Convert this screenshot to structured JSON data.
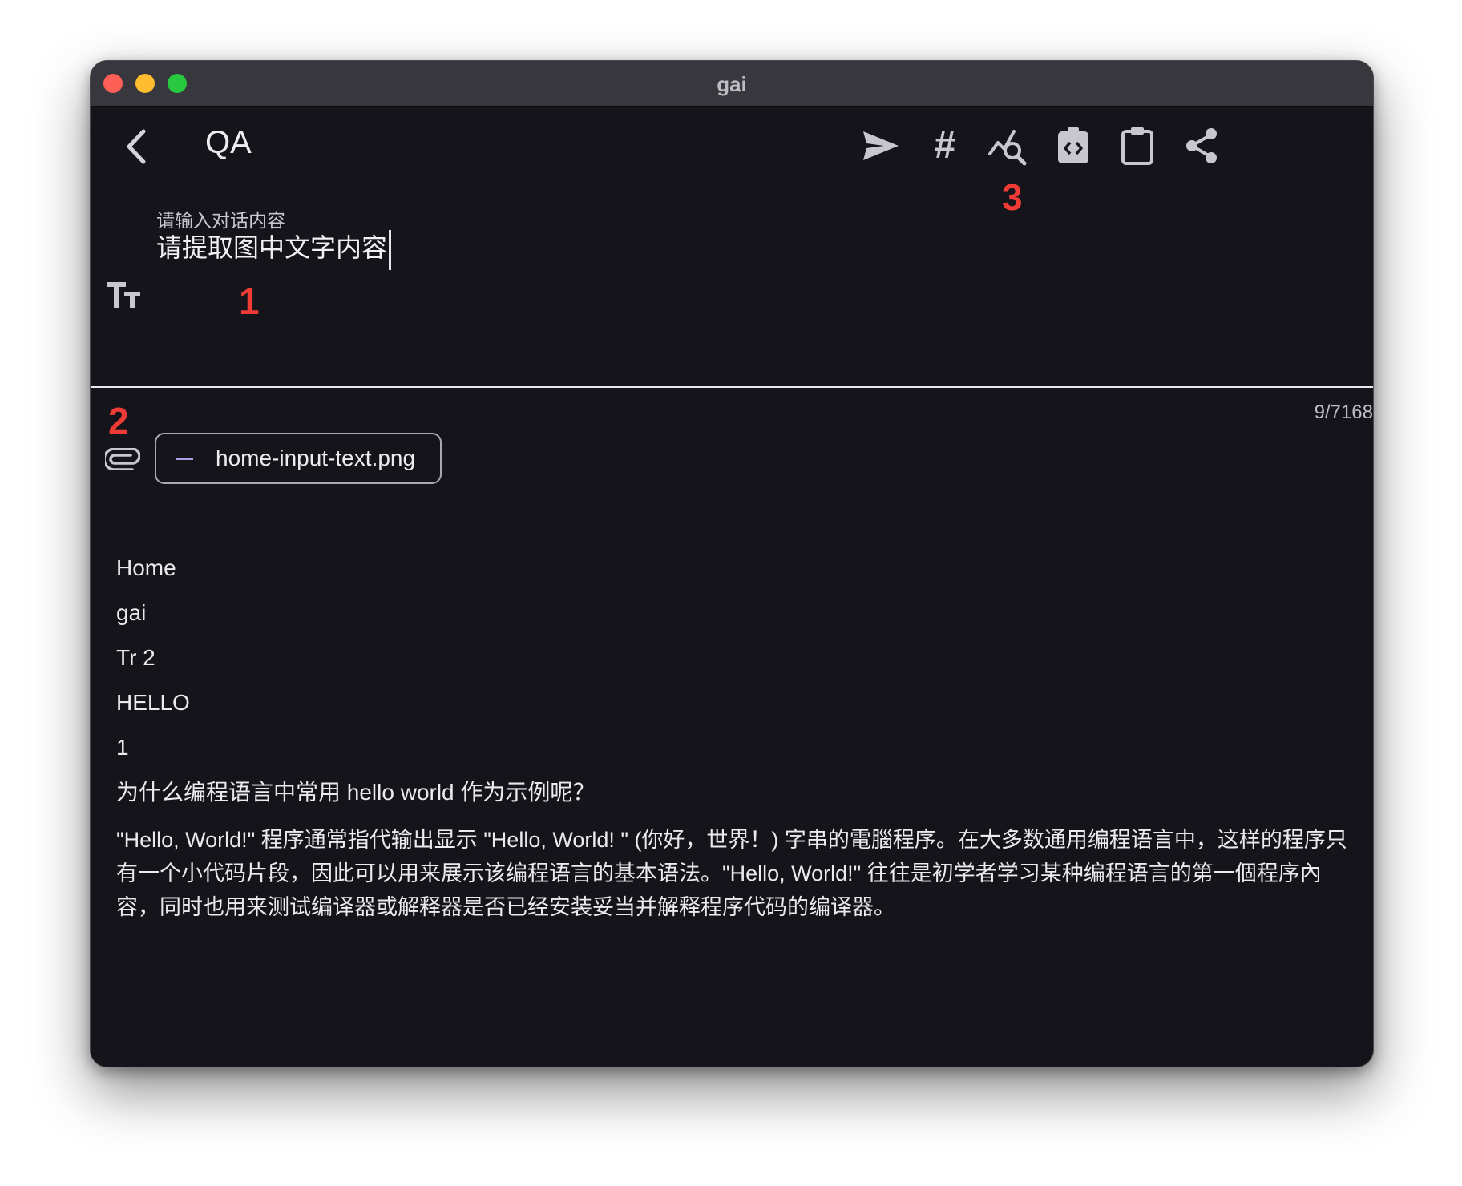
{
  "window": {
    "title": "gai"
  },
  "toolbar": {
    "page_title": "QA",
    "icons": [
      "chevron-left-icon",
      "send-icon",
      "hash-icon",
      "analytics-search-icon",
      "code-clipboard-icon",
      "clipboard-icon",
      "share-icon"
    ],
    "hash_glyph": "#"
  },
  "markers": {
    "one": "1",
    "two": "2",
    "three": "3"
  },
  "input": {
    "label": "请输入对话内容",
    "value": "请提取图中文字内容"
  },
  "char_count": "9/7168",
  "attachment": {
    "filename": "home-input-text.png"
  },
  "content": {
    "lines": [
      "Home",
      "gai",
      "Tr 2",
      "HELLO",
      "1",
      "为什么编程语言中常用 hello world 作为示例呢？"
    ],
    "paragraph": "\"Hello, World!\" 程序通常指代输出显示 \"Hello, World! \" (你好，世界！) 字串的電腦程序。在大多数通用编程语言中，这样的程序只有一个小代码片段，因此可以用来展示该编程语言的基本语法。\"Hello, World!\" 往往是初学者学习某种编程语言的第一個程序內容，同时也用来测试编译器或解释器是否已经安装妥当并解释程序代码的编译器。"
  },
  "colors": {
    "background": "#15141b",
    "titlebar": "#38373d",
    "marker": "#ef3b36",
    "accent": "#a7a2e8"
  }
}
